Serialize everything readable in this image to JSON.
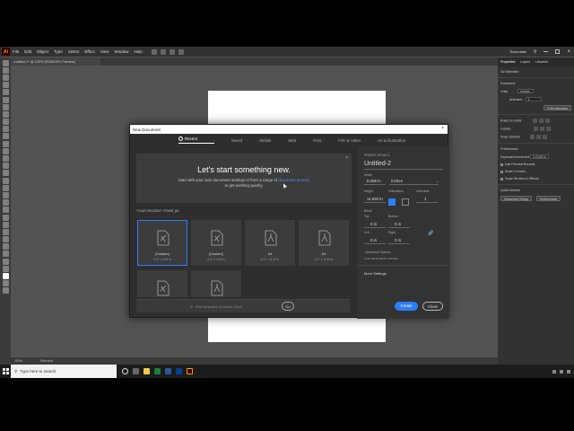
{
  "app": {
    "logo": "Ai",
    "menu": [
      "File",
      "Edit",
      "Object",
      "Type",
      "Select",
      "Effect",
      "View",
      "Window",
      "Help"
    ],
    "workspace": "Essentials",
    "document_tab": "Untitled-1* @ 100% (RGB/GPU Preview)"
  },
  "statusbar": {
    "zoom": "100%",
    "tool": "Selection"
  },
  "properties_panel": {
    "tabs": [
      "Properties",
      "Layers",
      "Libraries"
    ],
    "selection": "No Selection",
    "document_head": "Document",
    "units_label": "Units",
    "units_value": "Inches",
    "artboard_label": "Artboard",
    "artboard_value": "1",
    "edit_artboards": "Edit Artboards",
    "rulers_grids": "Rulers & Grids",
    "guides": "Guides",
    "snap_options": "Snap Options",
    "preferences": "Preferences",
    "keyboard_increment_label": "Keyboard Increment",
    "keyboard_increment_value": "0.0139 in",
    "use_preview_bounds": "Use Preview Bounds",
    "scale_corners": "Scale Corners",
    "scale_strokes": "Scale Strokes & Effects",
    "quick_actions": "Quick Actions",
    "document_setup": "Document Setup",
    "preferences_btn": "Preferences"
  },
  "dialog": {
    "title": "New Document",
    "tabs": [
      "Recent",
      "Saved",
      "Mobile",
      "Web",
      "Print",
      "Film & Video",
      "Art & Illustration"
    ],
    "active_tab": "Recent",
    "banner_title": "Let's start something new.",
    "banner_text_1": "Start with your own document settings or from a range of",
    "banner_link": "document presets",
    "banner_text_2": "to get working quickly.",
    "recent_header": "YOUR RECENT ITEMS",
    "recent_count": "(6)",
    "presets": [
      {
        "name": "[Custom]",
        "dims": "8.27 x 9.69 in",
        "selected": true
      },
      {
        "name": "[Custom]",
        "dims": "8.27 x 19.6 in",
        "selected": false
      },
      {
        "name": "A4",
        "dims": "8.27 x 11.69 in",
        "selected": false
      },
      {
        "name": "A4",
        "dims": "8.27 x 11.69 in",
        "selected": false
      }
    ],
    "stock_search_placeholder": "Find templates on Adobe Stock",
    "go": "Go",
    "details_header": "PRESET DETAILS",
    "doc_name": "Untitled-2",
    "width_label": "Width",
    "width_value": "8.268 in",
    "units_value": "Inches",
    "height_label": "Height",
    "height_value": "11.693 in",
    "orientation_label": "Orientation",
    "artboards_label": "Artboards",
    "artboards_value": "1",
    "bleed_label": "Bleed",
    "top_label": "Top",
    "top_value": "0 in",
    "bottom_label": "Bottom",
    "bottom_value": "0 in",
    "left_label": "Left",
    "left_value": "0 in",
    "right_label": "Right",
    "right_value": "0 in",
    "advanced_options": "Advanced Options",
    "color_mode": "Color Mode:CMYK, PPI:300",
    "more_settings": "More Settings",
    "create": "Create",
    "close": "Close"
  },
  "taskbar": {
    "search_placeholder": "Type here to search"
  }
}
